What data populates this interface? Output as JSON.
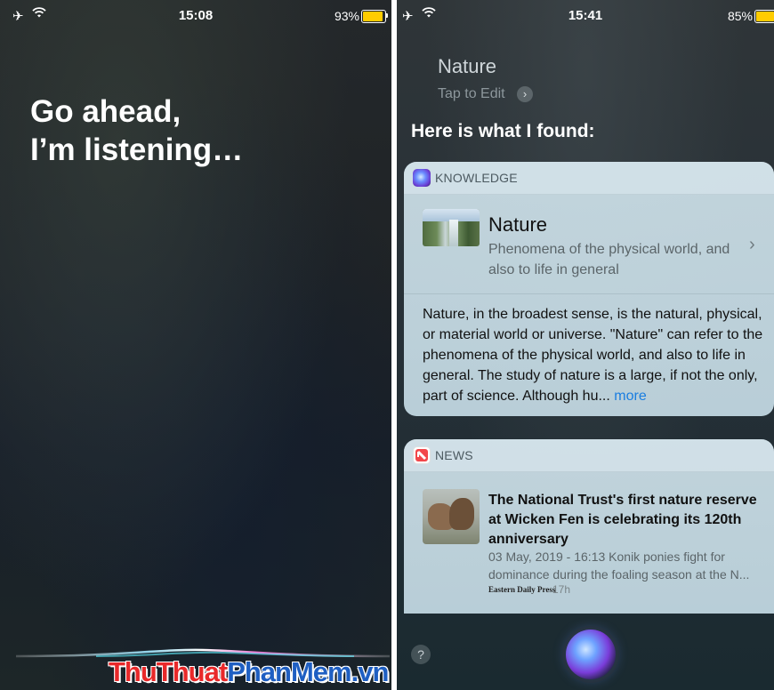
{
  "left": {
    "status": {
      "time": "15:08",
      "battery": "93%",
      "battery_level": 0.93
    },
    "prompt_line1": "Go ahead,",
    "prompt_line2": "I’m listening…",
    "watermark_part1": "ThuThuat",
    "watermark_part2": "PhanMem",
    "watermark_part3": ".vn"
  },
  "right": {
    "status": {
      "time": "15:41",
      "battery": "85%",
      "battery_level": 0.85
    },
    "query": "Nature",
    "tap_to_edit": "Tap to Edit",
    "found_heading": "Here is what I found:",
    "knowledge": {
      "header": "KNOWLEDGE",
      "title": "Nature",
      "subtitle": "Phenomena of the physical world, and also to life in general",
      "body": "Nature, in the broadest sense, is the natural, physical, or material world or universe. \"Nature\" can refer to the phenomena of the physical world, and also to life in general. The study of nature is a large, if not the only, part of science. Although hu...",
      "more": "more"
    },
    "news": {
      "header": "NEWS",
      "title": "The National Trust's first nature reserve at Wicken Fen is celebrating its 120th anniversary",
      "subtitle": "03 May, 2019 - 16:13 Konik ponies fight for dominance during the foaling season at the N...",
      "source": "Eastern Daily Press",
      "age": "17h"
    },
    "help_label": "?"
  },
  "colors": {
    "battery_fill": "#ffcc00",
    "link": "#1a7ee0",
    "watermark_red": "#e8292a",
    "watermark_blue": "#1f5fc2"
  },
  "icons": [
    "airplane-icon",
    "wifi-icon",
    "battery-icon",
    "chevron-right-icon",
    "siri-knowledge-icon",
    "news-app-icon",
    "siri-orb-icon",
    "help-icon"
  ]
}
